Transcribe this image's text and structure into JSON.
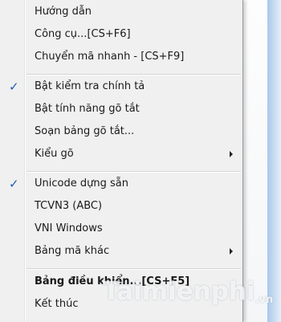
{
  "menu": {
    "items": [
      {
        "label": "Hướng dẫn",
        "checked": false,
        "submenu": false,
        "bold": false
      },
      {
        "label": "Công cụ...[CS+F6]",
        "checked": false,
        "submenu": false,
        "bold": false
      },
      {
        "label": "Chuyển mã nhanh - [CS+F9]",
        "checked": false,
        "submenu": false,
        "bold": false
      },
      {
        "label": "Bật kiểm tra chính tả",
        "checked": true,
        "submenu": false,
        "bold": false
      },
      {
        "label": "Bật tính năng gõ tắt",
        "checked": false,
        "submenu": false,
        "bold": false
      },
      {
        "label": "Soạn bảng gõ tắt...",
        "checked": false,
        "submenu": false,
        "bold": false
      },
      {
        "label": "Kiểu gõ",
        "checked": false,
        "submenu": true,
        "bold": false
      },
      {
        "label": "Unicode dựng sẵn",
        "checked": true,
        "submenu": false,
        "bold": false
      },
      {
        "label": "TCVN3 (ABC)",
        "checked": false,
        "submenu": false,
        "bold": false
      },
      {
        "label": "VNI Windows",
        "checked": false,
        "submenu": false,
        "bold": false
      },
      {
        "label": "Bảng mã khác",
        "checked": false,
        "submenu": true,
        "bold": false
      },
      {
        "label": "Bảng điều khiển...[CS+F5]",
        "checked": false,
        "submenu": false,
        "bold": true
      },
      {
        "label": "Kết thúc",
        "checked": false,
        "submenu": false,
        "bold": false
      }
    ],
    "check_glyph": "✓"
  },
  "watermark": {
    "text": "Taimienphi",
    "suffix": ".vn"
  },
  "colors": {
    "menu_bg": "#f0f0f0",
    "check": "#1a5fb4",
    "text": "#1a1a1a"
  }
}
